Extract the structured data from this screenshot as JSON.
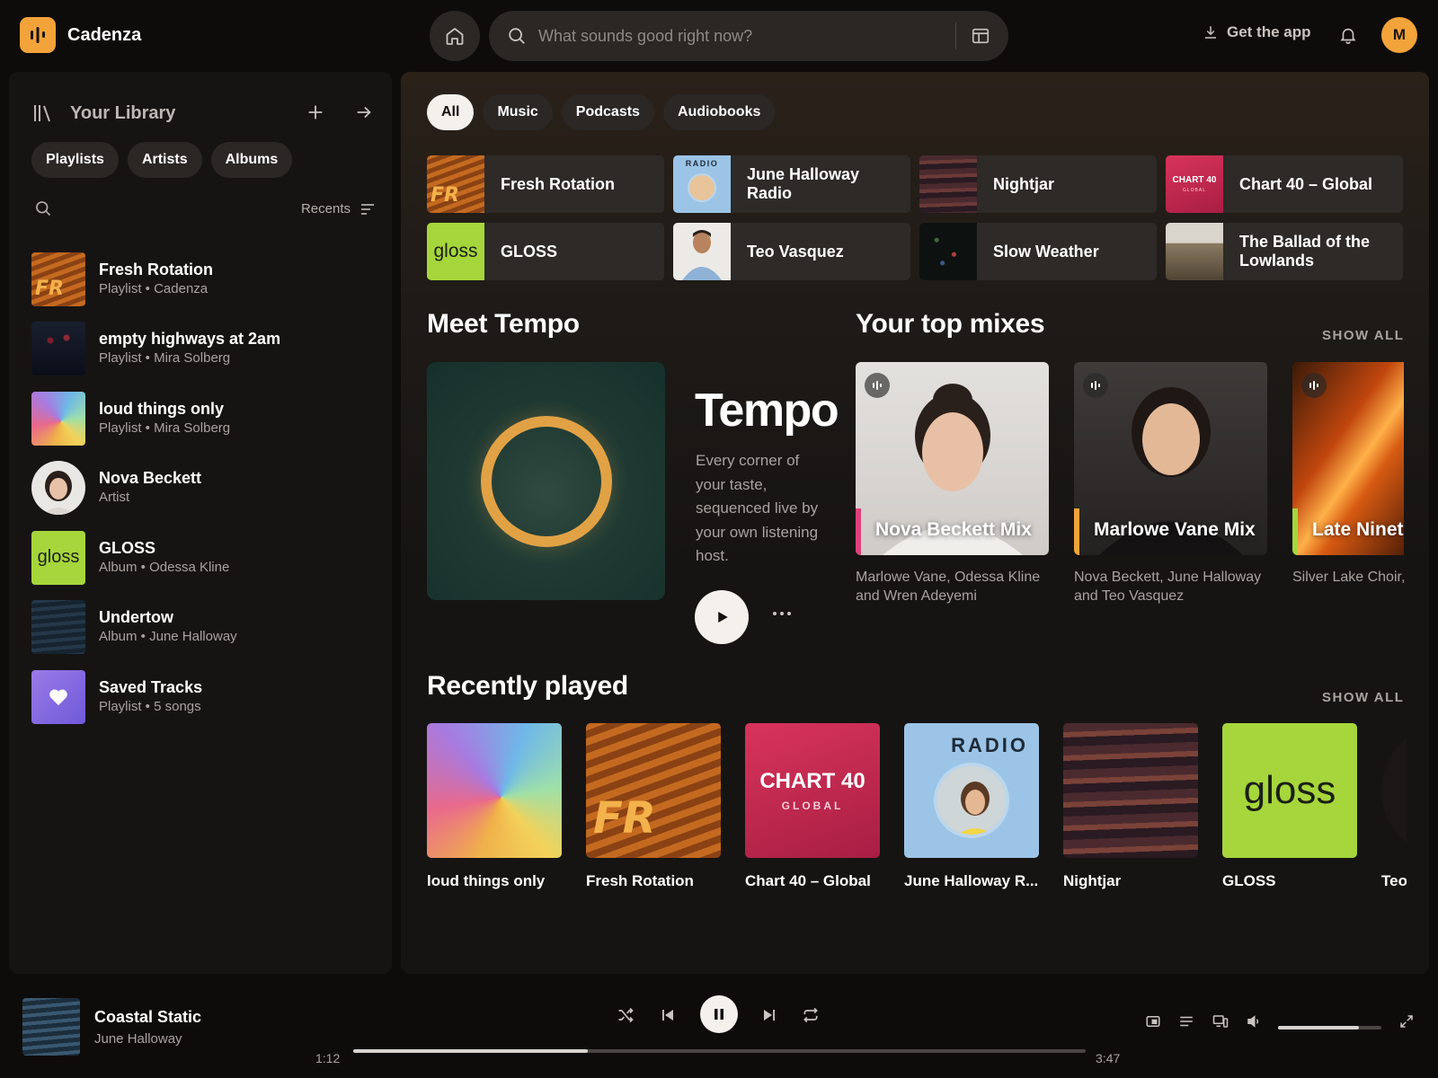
{
  "app": {
    "name": "Cadenza"
  },
  "header": {
    "search_placeholder": "What sounds good right now?",
    "get_app_label": "Get the app",
    "user_initial": "M"
  },
  "library": {
    "title": "Your Library",
    "chips": [
      "Playlists",
      "Artists",
      "Albums"
    ],
    "sort_label": "Recents",
    "items": [
      {
        "name": "Fresh Rotation",
        "sub": "Playlist • Cadenza",
        "art": "fresh-rotation"
      },
      {
        "name": "empty highways at 2am",
        "sub": "Playlist • Mira Solberg",
        "art": "highways"
      },
      {
        "name": "loud things only",
        "sub": "Playlist • Mira Solberg",
        "art": "loud"
      },
      {
        "name": "Nova Beckett",
        "sub": "Artist",
        "art": "nova"
      },
      {
        "name": "GLOSS",
        "sub": "Album • Odessa Kline",
        "art": "gloss"
      },
      {
        "name": "Undertow",
        "sub": "Album • June Halloway",
        "art": "undertow"
      },
      {
        "name": "Saved Tracks",
        "sub": "Playlist • 5 songs",
        "art": "saved"
      }
    ]
  },
  "main": {
    "filters": [
      "All",
      "Music",
      "Podcasts",
      "Audiobooks"
    ],
    "active_filter": "All",
    "quick": [
      {
        "name": "Fresh Rotation",
        "art": "fresh-rotation"
      },
      {
        "name": "June Halloway Radio",
        "art": "radio"
      },
      {
        "name": "Nightjar",
        "art": "nightjar"
      },
      {
        "name": "Chart 40 – Global",
        "art": "chart40"
      },
      {
        "name": "GLOSS",
        "art": "gloss"
      },
      {
        "name": "Teo Vasquez",
        "art": "teo"
      },
      {
        "name": "Slow Weather",
        "art": "slow"
      },
      {
        "name": "The Ballad of the Lowlands",
        "art": "ballad"
      }
    ],
    "tempo": {
      "section_title": "Meet Tempo",
      "name": "Tempo",
      "description": "Every corner of your taste, sequenced live by your own listening host."
    },
    "mixes": {
      "section_title": "Your top mixes",
      "show_all": "SHOW ALL",
      "items": [
        {
          "title": "Nova Beckett Mix",
          "sub": "Marlowe Vane, Odessa Kline and Wren Adeyemi",
          "bar_color": "#e0407a"
        },
        {
          "title": "Marlowe Vane Mix",
          "sub": "Nova Beckett, June Halloway and Teo Vasquez",
          "bar_color": "#f2a33a"
        },
        {
          "title": "Late Nineties",
          "sub": "Silver Lake Choir, Tran, The…",
          "bar_color": "#a6d63c"
        }
      ]
    },
    "recent": {
      "section_title": "Recently played",
      "show_all": "SHOW ALL",
      "items": [
        {
          "name": "loud things only",
          "art": "loud"
        },
        {
          "name": "Fresh Rotation",
          "art": "fresh-rotation"
        },
        {
          "name": "Chart 40 – Global",
          "art": "chart40"
        },
        {
          "name": "June Halloway R...",
          "art": "radio"
        },
        {
          "name": "Nightjar",
          "art": "nightjar"
        },
        {
          "name": "GLOSS",
          "art": "gloss"
        },
        {
          "name": "Teo Vasquez",
          "art": "teo"
        }
      ]
    }
  },
  "art_text": {
    "fr": "FR",
    "gloss": "gloss",
    "chart_top": "CHART 40",
    "chart_bottom": "GLOBAL",
    "radio": "RADIO"
  },
  "player": {
    "title": "Coastal Static",
    "artist": "June Halloway",
    "elapsed": "1:12",
    "duration": "3:47",
    "progress_fraction": 0.32,
    "volume_fraction": 0.78
  },
  "colors": {
    "accent": "#f2a33a",
    "background": "#0e0c0b",
    "panel": "#161413",
    "card": "#2d2a27"
  }
}
